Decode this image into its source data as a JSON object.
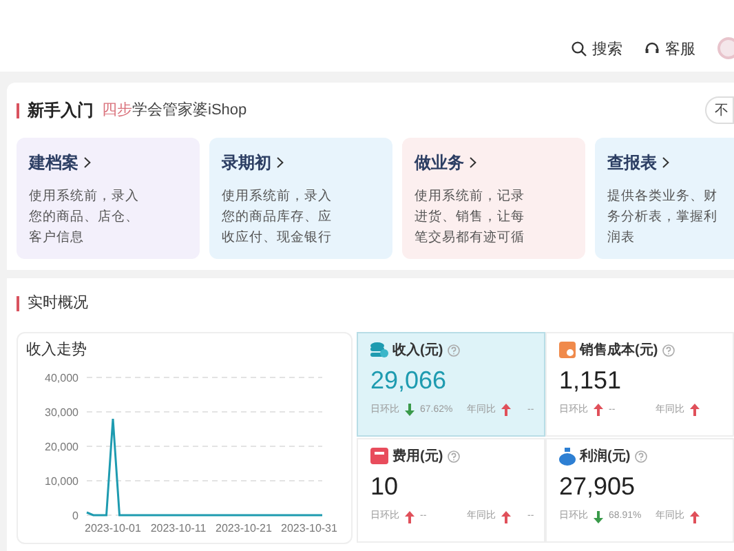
{
  "topbar": {
    "actions": [
      {
        "kind": "search",
        "label": "搜索"
      },
      {
        "kind": "service",
        "label": "客服"
      }
    ]
  },
  "guide": {
    "title": "新手入门",
    "subtitle": "**四步**学会管家婆iShop",
    "button": "不",
    "cards": [
      {
        "title": "建档案",
        "description": "使用系统前，录入您的商品、店仓、客户信息",
        "color": "#f3f0fb"
      },
      {
        "title": "录期初",
        "description": "使用系统前，录入您的商品库存、应收应付、现金银行",
        "color": "#e8f4fc"
      },
      {
        "title": "做业务",
        "description": "使用系统前，记录进货、销售，让每笔交易都有迹可循",
        "color": "#fcefef"
      },
      {
        "title": "查报表",
        "description": "提供各类业务、财务分析表，掌握利润表",
        "color": "#e8f4fc"
      }
    ]
  },
  "overview": {
    "title": "实时概况",
    "chart": {
      "title": "收入走势",
      "chart_data": {
        "type": "line",
        "x": [
          "2023-09-27",
          "2023-09-28",
          "2023-09-29",
          "2023-09-30",
          "2023-10-01",
          "2023-10-02",
          "2023-10-03",
          "2023-10-04",
          "2023-10-05",
          "2023-10-06",
          "2023-10-07",
          "2023-10-08",
          "2023-10-09",
          "2023-10-10",
          "2023-10-11",
          "2023-10-12",
          "2023-10-13",
          "2023-10-14",
          "2023-10-15",
          "2023-10-16",
          "2023-10-17",
          "2023-10-18",
          "2023-10-19",
          "2023-10-20",
          "2023-10-21",
          "2023-10-22",
          "2023-10-23",
          "2023-10-24",
          "2023-10-25",
          "2023-10-26",
          "2023-10-27",
          "2023-10-28",
          "2023-10-29",
          "2023-10-30",
          "2023-10-31",
          "2023-11-01",
          "2023-11-02"
        ],
        "series": [
          {
            "color": "#1e9bb0",
            "values": [
              800,
              0,
              0,
              0,
              28000,
              0,
              0,
              0,
              0,
              0,
              0,
              0,
              0,
              0,
              0,
              0,
              0,
              0,
              0,
              0,
              0,
              0,
              0,
              0,
              0,
              0,
              0,
              0,
              0,
              0,
              0,
              0,
              0,
              0,
              0,
              0,
              0
            ]
          }
        ],
        "xlim": [
          "2023-09-27",
          "2023-11-02"
        ],
        "ylim": [
          0,
          40000
        ],
        "grid": true,
        "yticks": [
          {
            "value": 0,
            "label": "0"
          },
          {
            "value": 10000,
            "label": "10,000"
          },
          {
            "value": 20000,
            "label": "20,000"
          },
          {
            "value": 30000,
            "label": "30,000"
          },
          {
            "value": 40000,
            "label": "40,000"
          }
        ],
        "xticks": [
          {
            "value": "2023-10-01",
            "label": "2023-10-01"
          },
          {
            "value": "2023-10-11",
            "label": "2023-10-11"
          },
          {
            "value": "2023-10-21",
            "label": "2023-10-21"
          },
          {
            "value": "2023-10-31",
            "label": "2023-10-31"
          }
        ]
      }
    },
    "stats": [
      {
        "kind": "income",
        "title": "收入(元)",
        "value": "29,066",
        "selected": true,
        "day_label": "日环比",
        "day_increase": false,
        "day_value": "67.62%",
        "year_label": "年同比",
        "year_increase": true,
        "year_value": "--"
      },
      {
        "kind": "cost",
        "title": "销售成本(元)",
        "value": "1,151",
        "selected": false,
        "day_label": "日环比",
        "day_increase": true,
        "day_value": "--",
        "year_label": "年同比",
        "year_increase": true
      },
      {
        "kind": "expense",
        "title": "费用(元)",
        "value": "10",
        "selected": false,
        "day_label": "日环比",
        "day_increase": true,
        "day_value": "--",
        "year_label": "年同比",
        "year_increase": true,
        "year_value": "--"
      },
      {
        "kind": "profit",
        "title": "利润(元)",
        "value": "27,905",
        "selected": false,
        "day_label": "日环比",
        "day_increase": false,
        "day_value": "68.91%",
        "year_label": "年同比",
        "year_increase": true
      }
    ]
  }
}
